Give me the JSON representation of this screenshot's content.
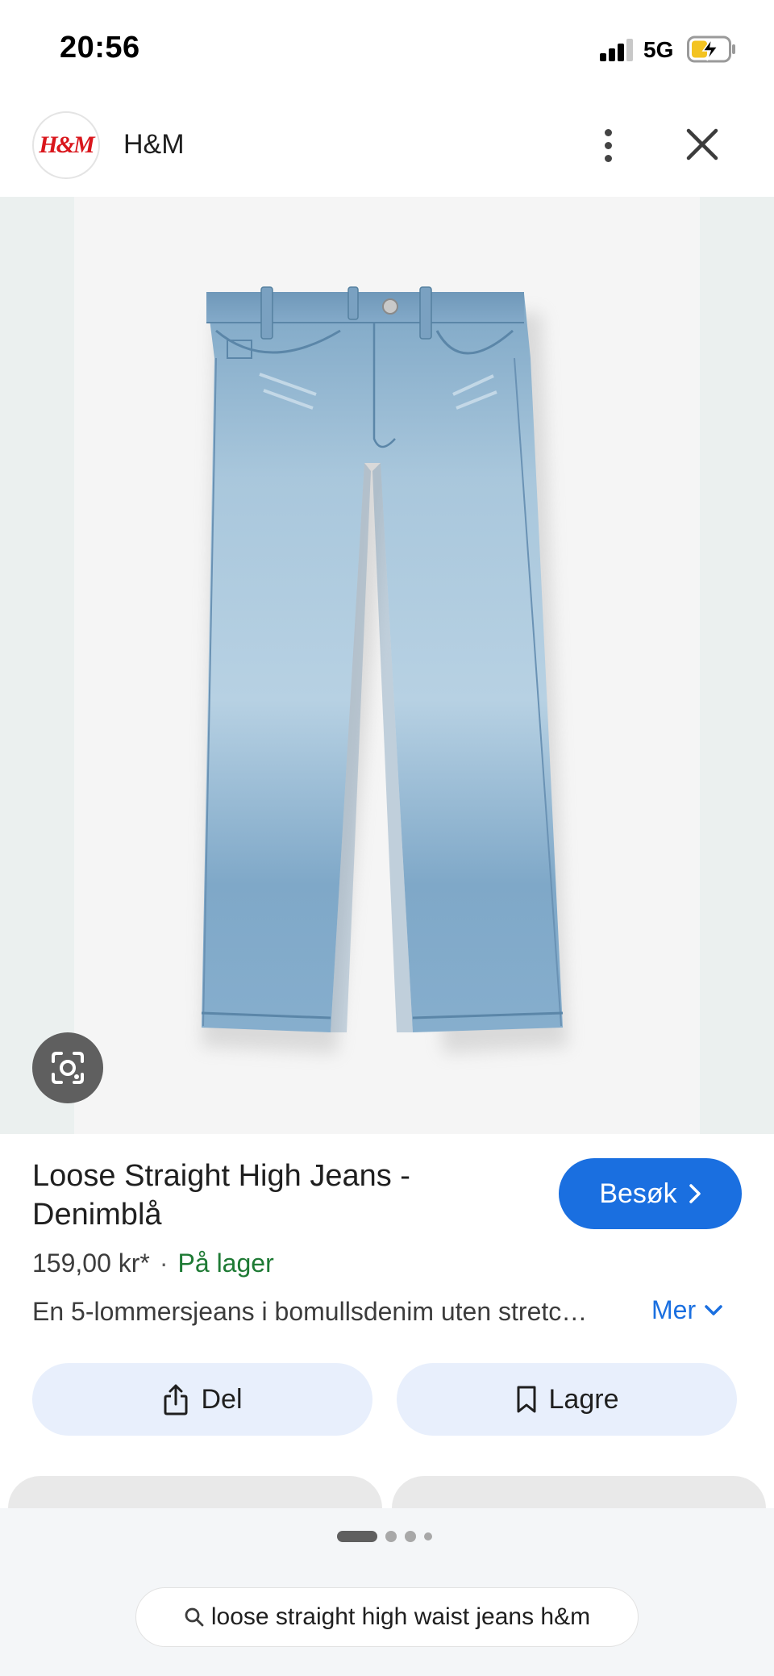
{
  "status_bar": {
    "time": "20:56",
    "network": "5G",
    "icons": [
      "signal-icon",
      "battery-charging-icon"
    ]
  },
  "header": {
    "logo_text": "H&M",
    "site_name": "H&M",
    "icons": [
      "more-vertical-icon",
      "close-icon"
    ]
  },
  "product": {
    "image_description_icon": "jeans-image",
    "title": "Loose Straight High Jeans - Denimblå",
    "visit_label": "Besøk",
    "price": "159,00 kr*",
    "separator": "·",
    "stock": "På lager",
    "description": "En 5-lommersjeans i bomullsdenim uten stretc…",
    "more_label": "Mer"
  },
  "actions": {
    "share_label": "Del",
    "save_label": "Lagre"
  },
  "search": {
    "query": "loose straight high waist jeans h&m"
  },
  "colors": {
    "accent": "#1a6fe0",
    "stock_green": "#1e7a34",
    "action_bg": "#e8effc",
    "brand_red": "#d9161c"
  }
}
